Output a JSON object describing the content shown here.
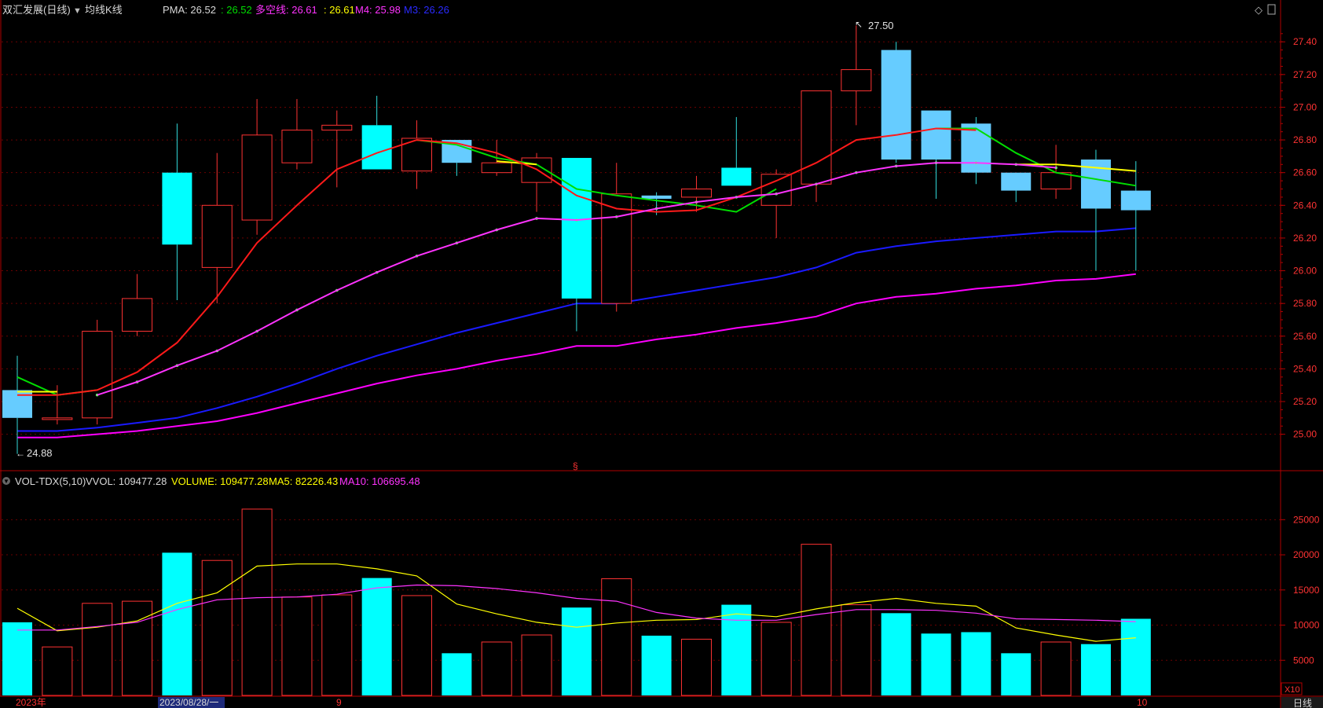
{
  "header": {
    "stock_name": "双汇发展(日线)",
    "indicator_name": "均线K线",
    "pma_label": "PMA: 26.52",
    "v1_label": ": 26.52",
    "duokong_label": "多空线: 26.61",
    "v2_label": ": 26.61",
    "m4_label": "M4: 25.98",
    "m3_label": "M3: 26.26",
    "diamond_icon": "◇",
    "toggle_label": "▌"
  },
  "volume_header": {
    "name": "VOL-TDX(5,10)",
    "vvol": "VVOL: 109477.28",
    "volume": "VOLUME: 109477.28",
    "ma5": "MA5: 82226.43",
    "ma10": "MA10: 106695.48"
  },
  "annotations": {
    "high_label": "27.50",
    "low_label": "24.88",
    "marker": "§"
  },
  "x_axis": {
    "labels": [
      "2023年",
      "2023/08/28/一",
      "9",
      "10"
    ]
  },
  "bottom_right": {
    "period_label": "日线",
    "multiplier_label": "X10"
  },
  "colors": {
    "background": "#000000",
    "up_red": "#ff3333",
    "down_cyan": "#00ffff",
    "down_light": "#66ccff",
    "pma": "#00dd00",
    "duokong": "#ffff00",
    "m4": "#ff00ff",
    "m3": "#0000ff",
    "ma_red": "#ff0000"
  },
  "chart_data": {
    "type": "candlestick",
    "price_axis": {
      "ticks": [
        25.0,
        25.2,
        25.4,
        25.6,
        25.8,
        26.0,
        26.2,
        26.4,
        26.6,
        26.8,
        27.0,
        27.2,
        27.4
      ],
      "ylim": [
        24.83,
        27.55
      ]
    },
    "volume_axis": {
      "ticks": [
        5000,
        10000,
        15000,
        20000,
        25000
      ],
      "ylim": [
        0,
        28500
      ],
      "unit_multiplier": "X10"
    },
    "candles": [
      {
        "o": 25.27,
        "h": 25.48,
        "l": 24.88,
        "c": 25.1,
        "dir": "down",
        "vol": 10400
      },
      {
        "o": 25.09,
        "h": 25.3,
        "l": 25.06,
        "c": 25.1,
        "dir": "up",
        "vol": 6900
      },
      {
        "o": 25.1,
        "h": 25.7,
        "l": 25.06,
        "c": 25.63,
        "dir": "up",
        "vol": 13100
      },
      {
        "o": 25.63,
        "h": 25.98,
        "l": 25.6,
        "c": 25.83,
        "dir": "up",
        "vol": 13400
      },
      {
        "o": 26.6,
        "h": 26.9,
        "l": 25.82,
        "c": 26.16,
        "dir": "down",
        "vol": 20300
      },
      {
        "o": 26.02,
        "h": 26.72,
        "l": 25.8,
        "c": 26.4,
        "dir": "up",
        "vol": 19200
      },
      {
        "o": 26.31,
        "h": 27.05,
        "l": 26.22,
        "c": 26.83,
        "dir": "up",
        "vol": 26500
      },
      {
        "o": 26.66,
        "h": 27.05,
        "l": 26.62,
        "c": 26.86,
        "dir": "up",
        "vol": 14000
      },
      {
        "o": 26.86,
        "h": 26.98,
        "l": 26.51,
        "c": 26.89,
        "dir": "up",
        "vol": 14300
      },
      {
        "o": 26.89,
        "h": 27.07,
        "l": 26.62,
        "c": 26.62,
        "dir": "down",
        "vol": 16700
      },
      {
        "o": 26.61,
        "h": 26.92,
        "l": 26.5,
        "c": 26.81,
        "dir": "up",
        "vol": 14200
      },
      {
        "o": 26.8,
        "h": 26.8,
        "l": 26.58,
        "c": 26.66,
        "dir": "down",
        "vol": 6000
      },
      {
        "o": 26.6,
        "h": 26.8,
        "l": 26.58,
        "c": 26.66,
        "dir": "up",
        "vol": 7600
      },
      {
        "o": 26.54,
        "h": 26.72,
        "l": 26.36,
        "c": 26.69,
        "dir": "up",
        "vol": 8600
      },
      {
        "o": 26.69,
        "h": 26.69,
        "l": 25.63,
        "c": 25.83,
        "dir": "down",
        "vol": 12500
      },
      {
        "o": 25.8,
        "h": 26.66,
        "l": 25.75,
        "c": 26.47,
        "dir": "up",
        "vol": 16600
      },
      {
        "o": 26.46,
        "h": 26.48,
        "l": 26.34,
        "c": 26.44,
        "dir": "down",
        "vol": 8500
      },
      {
        "o": 26.45,
        "h": 26.58,
        "l": 26.36,
        "c": 26.5,
        "dir": "up",
        "vol": 8000
      },
      {
        "o": 26.63,
        "h": 26.94,
        "l": 26.52,
        "c": 26.52,
        "dir": "down",
        "vol": 12900
      },
      {
        "o": 26.4,
        "h": 26.62,
        "l": 26.2,
        "c": 26.59,
        "dir": "up",
        "vol": 10400
      },
      {
        "o": 26.53,
        "h": 27.1,
        "l": 26.42,
        "c": 27.1,
        "dir": "up",
        "vol": 21500
      },
      {
        "o": 27.1,
        "h": 27.5,
        "l": 26.89,
        "c": 27.23,
        "dir": "up",
        "vol": 12900
      },
      {
        "o": 27.35,
        "h": 27.4,
        "l": 26.66,
        "c": 26.68,
        "dir": "down",
        "vol": 11700
      },
      {
        "o": 26.98,
        "h": 26.98,
        "l": 26.44,
        "c": 26.68,
        "dir": "down",
        "vol": 8800
      },
      {
        "o": 26.9,
        "h": 26.94,
        "l": 26.53,
        "c": 26.6,
        "dir": "down",
        "vol": 9000
      },
      {
        "o": 26.6,
        "h": 26.6,
        "l": 26.42,
        "c": 26.49,
        "dir": "down",
        "vol": 6000
      },
      {
        "o": 26.5,
        "h": 26.77,
        "l": 26.44,
        "c": 26.6,
        "dir": "up",
        "vol": 7600
      },
      {
        "o": 26.68,
        "h": 26.74,
        "l": 26.0,
        "c": 26.38,
        "dir": "down",
        "vol": 7300
      },
      {
        "o": 26.49,
        "h": 26.67,
        "l": 26.0,
        "c": 26.37,
        "dir": "down",
        "vol": 10900
      }
    ],
    "series": [
      {
        "name": "M3",
        "color": "#1a1aff",
        "values": [
          25.02,
          25.02,
          25.04,
          25.07,
          25.1,
          25.16,
          25.23,
          25.31,
          25.4,
          25.48,
          25.55,
          25.62,
          25.68,
          25.74,
          25.8,
          25.8,
          25.84,
          25.88,
          25.92,
          25.96,
          26.02,
          26.11,
          26.15,
          26.18,
          26.2,
          26.22,
          26.24,
          26.24,
          26.26
        ]
      },
      {
        "name": "M4",
        "color": "#ff00ff",
        "values": [
          24.98,
          24.98,
          25.0,
          25.02,
          25.05,
          25.08,
          25.13,
          25.19,
          25.25,
          25.31,
          25.36,
          25.4,
          25.45,
          25.49,
          25.54,
          25.54,
          25.58,
          25.61,
          25.65,
          25.68,
          25.72,
          25.8,
          25.84,
          25.86,
          25.89,
          25.91,
          25.94,
          25.95,
          25.98
        ]
      }
    ],
    "volume_ma5": [
      12400,
      9200,
      9700,
      10600,
      13100,
      14600,
      18400,
      18700,
      18700,
      18000,
      17000,
      13000,
      11600,
      10400,
      9700,
      10300,
      10700,
      10800,
      11600,
      11200,
      12300,
      13200,
      13800,
      13100,
      12700,
      9600,
      8600,
      7700,
      8200
    ],
    "volume_ma10": [
      9300,
      9300,
      9800,
      10400,
      12200,
      13600,
      13900,
      14000,
      14400,
      15300,
      15700,
      15600,
      15200,
      14600,
      13800,
      13400,
      11800,
      11000,
      10700,
      10700,
      11500,
      12200,
      12200,
      12100,
      11700,
      10900,
      10800,
      10700,
      10500
    ]
  }
}
